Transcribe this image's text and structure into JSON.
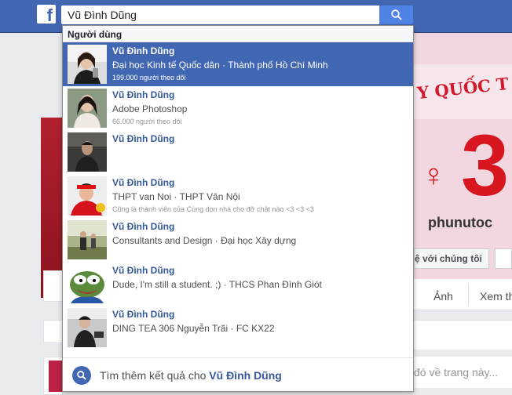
{
  "header": {
    "logo": "f",
    "search_value": "Vũ Đình Dũng"
  },
  "dropdown": {
    "section_title": "Người dùng",
    "results": [
      {
        "name": "Vũ Đình Dũng",
        "subtitle": "Đại học Kinh tế Quốc dân · Thành phố Hồ Chí Minh",
        "meta": "199.000 người theo dõi",
        "selected": true
      },
      {
        "name": "Vũ Đình Dũng",
        "subtitle": "Adobe Photoshop",
        "meta": "66.000 người theo dõi",
        "selected": false
      },
      {
        "name": "Vũ Đình Dũng",
        "subtitle": "",
        "meta": "",
        "selected": false
      },
      {
        "name": "Vũ Đình Dũng",
        "subtitle": "THPT van Noi · THPT Vân Nội",
        "meta": "Cũng là thành viên của Cùng dọn nhà cho đỡ chật nào <3 <3 <3",
        "selected": false
      },
      {
        "name": "Vũ Đình Dũng",
        "subtitle": "Consultants and Design · Đại học Xây dựng",
        "meta": "",
        "selected": false
      },
      {
        "name": "Vũ Đình Dũng",
        "subtitle": "Dude, I'm still a student. ;) · THCS Phan Đình Giót",
        "meta": "",
        "selected": false
      },
      {
        "name": "Vũ Đình Dũng",
        "subtitle": "DING TEA 306 Nguyễn Trãi · FC KX22",
        "meta": "",
        "selected": false
      }
    ],
    "footer_prefix": "Tìm thêm kết quả cho ",
    "footer_query": "Vũ Đình Dũng"
  },
  "background": {
    "cover_text": "Y QUỐC T",
    "cover_big": "3",
    "cover_site": "phunutoc",
    "contact_button": "ệ với chúng tôi",
    "tab_photos": "Ảnh",
    "tab_more": "Xem th",
    "post_placeholder": "đó về trang này..."
  },
  "colors": {
    "fb_blue": "#4267b2",
    "link_blue": "#365899",
    "cover_red": "#d8161f"
  }
}
